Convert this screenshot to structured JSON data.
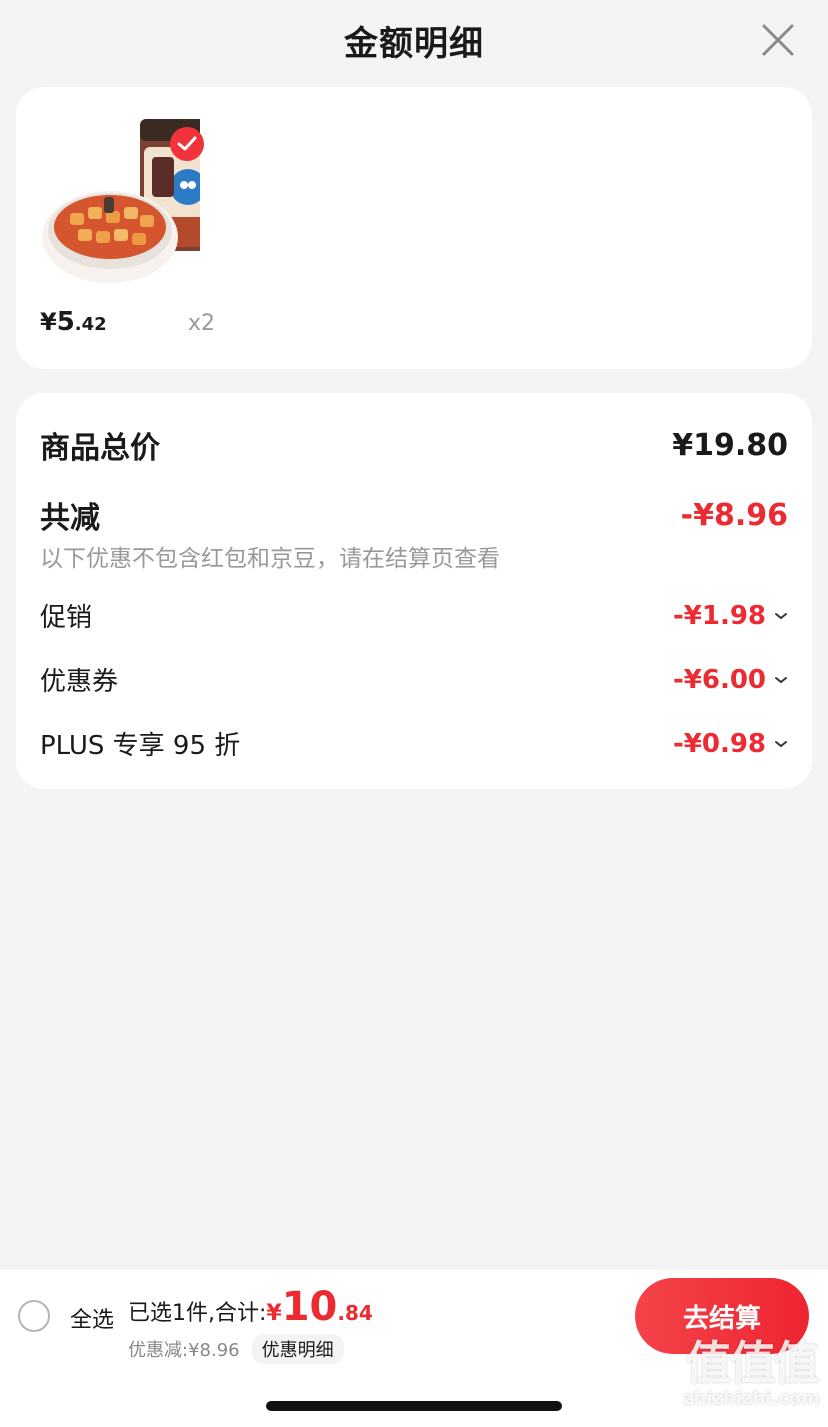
{
  "header": {
    "title": "金额明细"
  },
  "product": {
    "price_yen": "¥",
    "price_int": "5",
    "price_dec": ".42",
    "quantity": "x2"
  },
  "summary": {
    "total_label": "商品总价",
    "total_value": "¥19.80",
    "reduce_label": "共减",
    "reduce_value": "-¥8.96",
    "note": "以下优惠不包含红包和京豆，请在结算页查看",
    "items": [
      {
        "label": "促销",
        "value": "-¥1.98"
      },
      {
        "label": "优惠券",
        "value": "-¥6.00"
      },
      {
        "label": "PLUS 专享 95 折",
        "value": "-¥0.98"
      }
    ]
  },
  "bottom": {
    "select_all": "全选",
    "selected_text": "已选1件,合计:",
    "total_yen": "¥",
    "total_int": "10",
    "total_dec": ".84",
    "discount_text": "优惠减:¥8.96",
    "detail_link": "优惠明细",
    "checkout": "去结算"
  },
  "watermark": {
    "big": "值值值",
    "small": "zhizhizhi.com"
  },
  "colors": {
    "accent": "#ec2a31",
    "background": "#f4f4f4",
    "card": "#ffffff"
  },
  "icons": {
    "close": "close-icon",
    "check": "checkmark-icon",
    "chevron": "chevron-down-icon"
  }
}
